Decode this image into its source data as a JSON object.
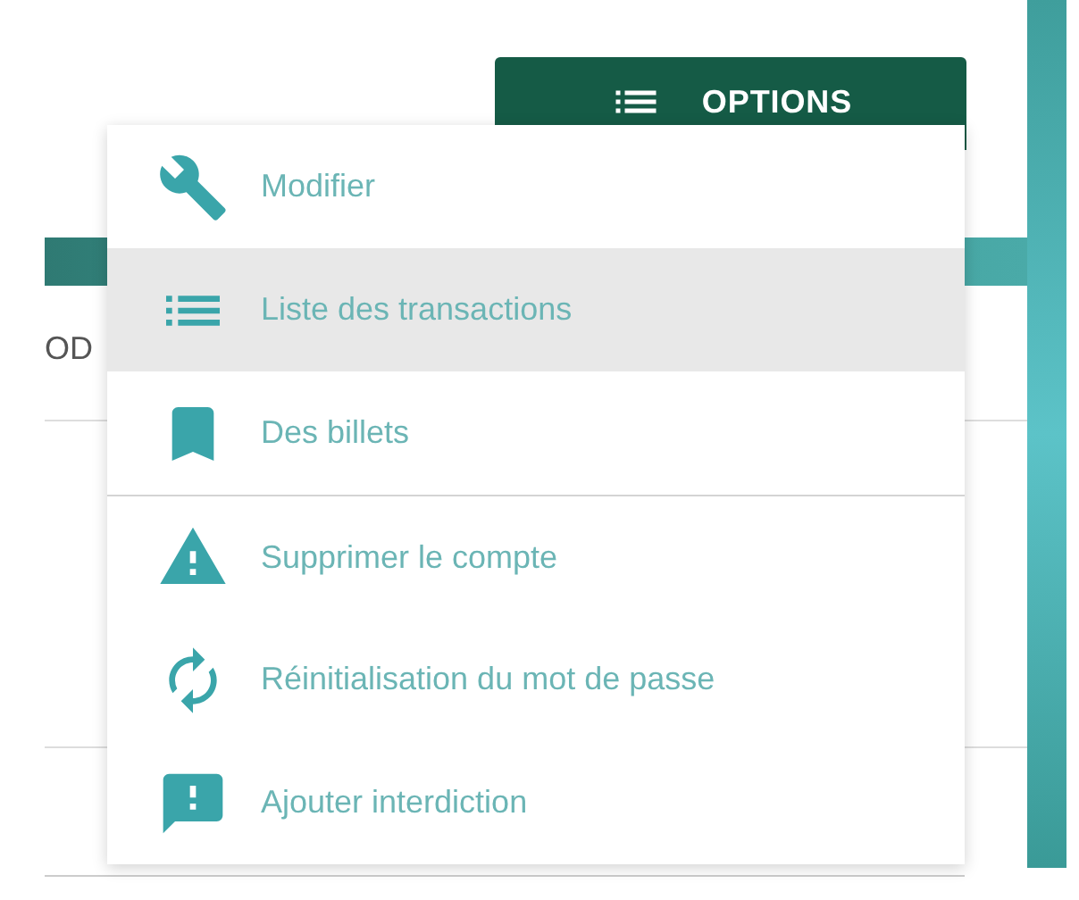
{
  "options_button": {
    "label": "OPTIONS"
  },
  "background_text": "OD",
  "menu": {
    "items": [
      {
        "label": "Modifier",
        "selected": false,
        "separator_before": false
      },
      {
        "label": "Liste des transactions",
        "selected": true,
        "separator_before": false
      },
      {
        "label": "Des billets",
        "selected": false,
        "separator_before": false
      },
      {
        "label": "Supprimer le compte",
        "selected": false,
        "separator_before": true
      },
      {
        "label": "Réinitialisation du mot de passe",
        "selected": false,
        "separator_before": false
      },
      {
        "label": "Ajouter interdiction",
        "selected": false,
        "separator_before": false
      }
    ]
  }
}
